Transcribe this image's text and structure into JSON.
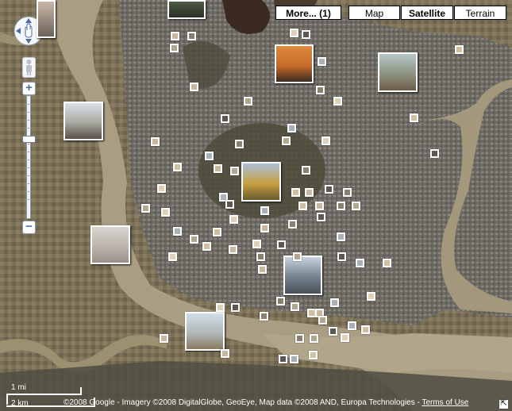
{
  "map_type_controls": {
    "more_label": "More... (1)",
    "map_label": "Map",
    "satellite_label": "Satellite",
    "terrain_label": "Terrain",
    "active": "Satellite"
  },
  "zoom": {
    "in_label": "+",
    "out_label": "−"
  },
  "scale": {
    "mi_label": "1 mi",
    "km_label": "2 km"
  },
  "copyright": {
    "text": "©2008 Google - Imagery ©2008 DigitalGlobe, GeoEye, Map data ©2008 AND, Europa Technologies - ",
    "terms_label": "Terms of Use"
  },
  "colors": {
    "river": "#a99d82",
    "land": "#5d5a48",
    "farmland": "#7a6f58",
    "city": "#706c66",
    "park": "#4a4a38"
  }
}
